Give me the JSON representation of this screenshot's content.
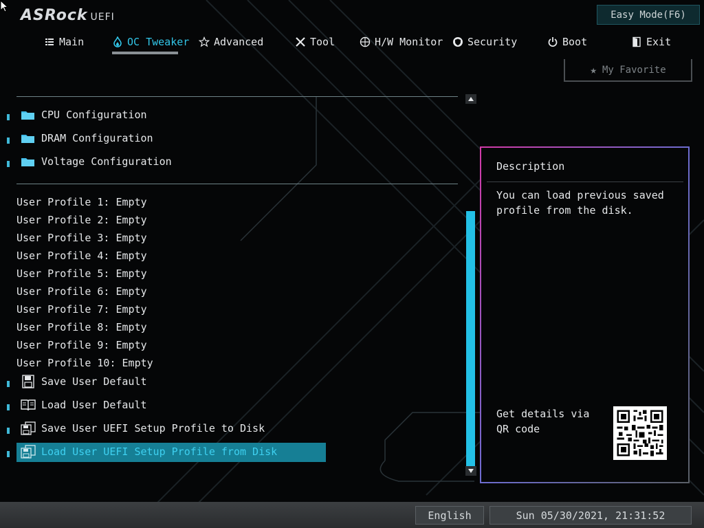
{
  "header": {
    "logo_main": "ASRock",
    "logo_sub": "UEFI",
    "easy_mode_label": "Easy Mode(F6)",
    "favorite_label": "My Favorite"
  },
  "nav": {
    "tabs": [
      {
        "label": "Main",
        "icon": "list-icon"
      },
      {
        "label": "OC Tweaker",
        "icon": "flame-icon",
        "active": true
      },
      {
        "label": "Advanced",
        "icon": "star-outline-icon"
      },
      {
        "label": "Tool",
        "icon": "wrench-icon"
      },
      {
        "label": "H/W Monitor",
        "icon": "crosshair-icon"
      },
      {
        "label": "Security",
        "icon": "shield-icon"
      },
      {
        "label": "Boot",
        "icon": "power-icon"
      },
      {
        "label": "Exit",
        "icon": "exit-door-icon"
      }
    ]
  },
  "menu": {
    "folders": [
      {
        "label": "CPU Configuration"
      },
      {
        "label": "DRAM Configuration"
      },
      {
        "label": "Voltage Configuration"
      }
    ],
    "profiles": [
      "User Profile 1: Empty",
      "User Profile 2: Empty",
      "User Profile 3: Empty",
      "User Profile 4: Empty",
      "User Profile 5: Empty",
      "User Profile 6: Empty",
      "User Profile 7: Empty",
      "User Profile 8: Empty",
      "User Profile 9: Empty",
      "User Profile 10: Empty"
    ],
    "actions": [
      {
        "label": "Save User Default",
        "icon": "floppy-icon"
      },
      {
        "label": "Load User Default",
        "icon": "book-icon"
      },
      {
        "label": "Save User UEFI Setup Profile to Disk",
        "icon": "disk-copy-icon"
      },
      {
        "label": "Load User UEFI Setup Profile from Disk",
        "icon": "disk-copy-icon",
        "selected": true
      }
    ]
  },
  "description": {
    "title": "Description",
    "text": "You can load previous saved profile from the disk.",
    "qr_text": "Get details via QR code"
  },
  "footer": {
    "language": "English",
    "datetime": "Sun 05/30/2021, 21:31:52"
  },
  "colors": {
    "accent": "#32c6e8",
    "selection": "#167f95",
    "scroll_thumb": "#23c0e6",
    "panel_border_top": "#d33aa8"
  }
}
